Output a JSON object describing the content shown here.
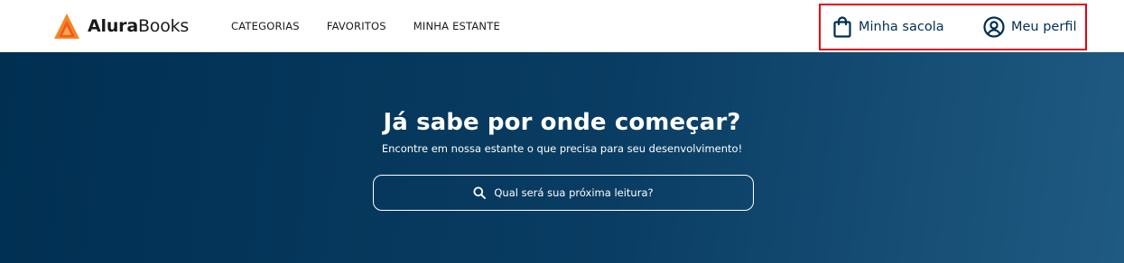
{
  "header": {
    "logo": {
      "bold": "Alura",
      "light": "Books",
      "accent_color": "#f6861f"
    },
    "nav": [
      {
        "label": "CATEGORIAS"
      },
      {
        "label": "FAVORITOS"
      },
      {
        "label": "MINHA ESTANTE"
      }
    ],
    "actions": {
      "bag_label": "Minha sacola",
      "bag_icon": "shopping-bag-icon",
      "profile_label": "Meu perfil",
      "profile_icon": "user-circle-icon",
      "highlight_color": "#e3000f"
    }
  },
  "hero": {
    "title": "Já sabe por onde começar?",
    "subtitle": "Encontre em nossa estante o que precisa para seu desenvolvimento!",
    "search_placeholder": "Qual será sua próxima leitura?",
    "search_icon": "search-icon",
    "background_color": "#002f52"
  }
}
